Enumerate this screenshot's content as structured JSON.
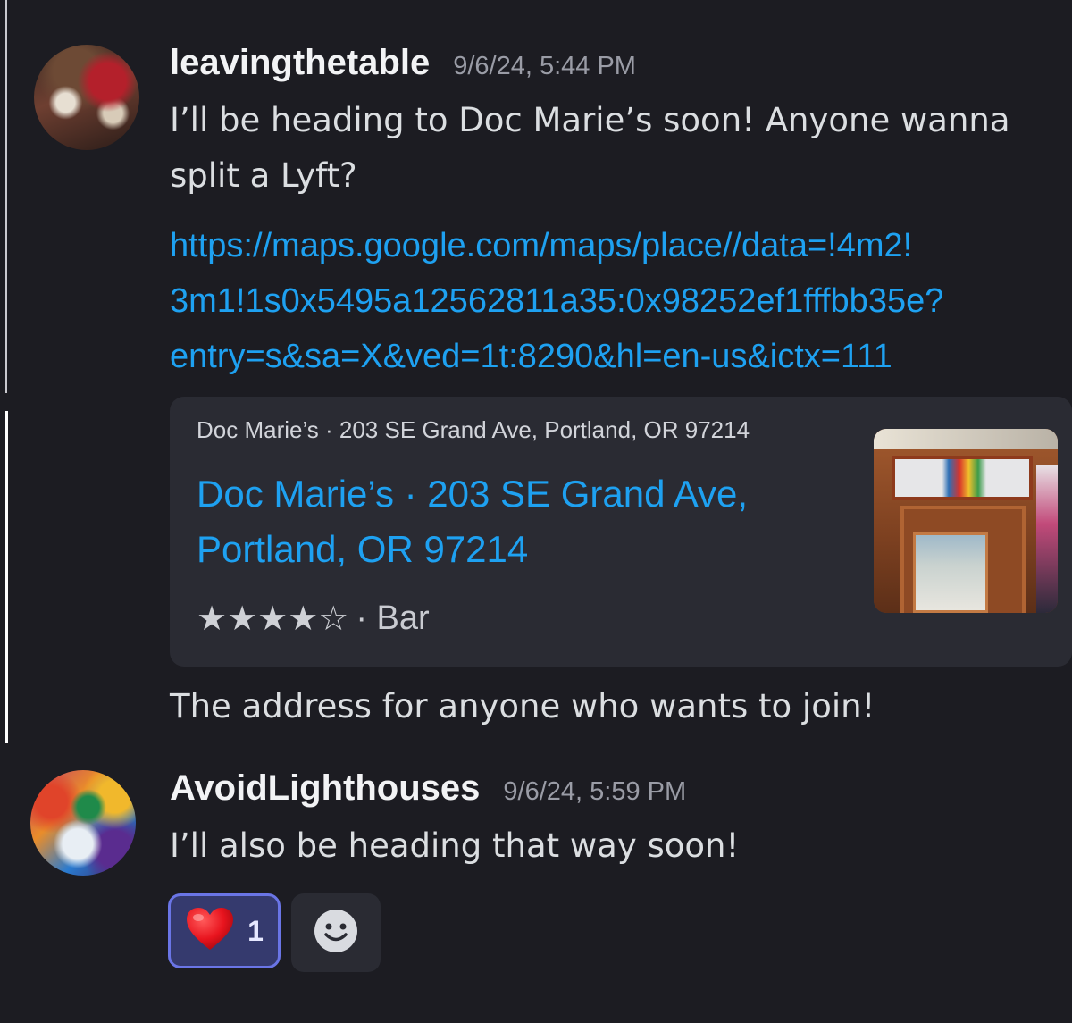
{
  "messages": [
    {
      "username": "leavingthetable",
      "timestamp": "9/6/24, 5:44 PM",
      "text": "I’ll be heading to Doc Marie’s soon! Anyone wanna\nsplit a Lyft?",
      "link": "https://maps.google.com/maps/place//data=!4m2!\n3m1!1s0x5495a12562811a35:0x98252ef1fffbb35e?\nentry=s&sa=X&ved=1t:8290&hl=en-us&ictx=111",
      "embed": {
        "provider": "Doc Marie’s · 203 SE Grand Ave, Portland, OR 97214",
        "title": "Doc Marie’s · 203 SE Grand Ave,\nPortland, OR 97214",
        "rating_stars": "★★★★☆",
        "rating": 4,
        "rating_max": 5,
        "category": "· Bar",
        "thumbnail": "storefront-door-photo"
      },
      "followup_text": "The address for anyone who wants to join!"
    },
    {
      "username": "AvoidLighthouses",
      "timestamp": "9/6/24, 5:59 PM",
      "text": "I’ll also be heading that way soon!",
      "reactions": [
        {
          "emoji": "❤️",
          "icon": "heart-icon",
          "count": "1"
        }
      ],
      "add_reaction_icon": "smiley-icon"
    }
  ],
  "colors": {
    "background": "#1c1c22",
    "link": "#1ea1f1",
    "embed_bg": "#2a2b33",
    "reaction_bg": "#353a6e",
    "reaction_border": "#6a75e6"
  }
}
